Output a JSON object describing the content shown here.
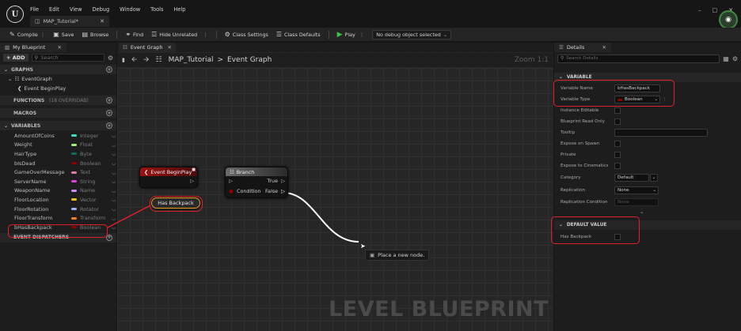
{
  "app": {
    "logo": "U",
    "tab_title": "MAP_Tutorial*"
  },
  "menu": [
    "File",
    "Edit",
    "View",
    "Debug",
    "Window",
    "Tools",
    "Help"
  ],
  "window_controls": [
    "–",
    "□",
    "✕"
  ],
  "toolbar": {
    "compile": "Compile",
    "save": "Save",
    "browse": "Browse",
    "find": "Find",
    "hide_unrelated": "Hide Unrelated",
    "class_settings": "Class Settings",
    "class_defaults": "Class Defaults",
    "play": "Play",
    "debug_select": "No debug object selected"
  },
  "my_blueprint": {
    "tab": "My Blueprint",
    "add": "ADD",
    "search_placeholder": "Search",
    "graphs_header": "GRAPHS",
    "event_graph": "EventGraph",
    "event_begin_play": "Event BeginPlay",
    "functions_header": "FUNCTIONS",
    "functions_sub": "(18 OVERRIDAB)",
    "macros_header": "MACROS",
    "variables_header": "VARIABLES",
    "variables": [
      {
        "name": "AmountOfCoins",
        "type": "Integer",
        "color": "#3ee0c0"
      },
      {
        "name": "Weight",
        "type": "Float",
        "color": "#a0f070"
      },
      {
        "name": "HairType",
        "type": "Byte",
        "color": "#0a6e5c"
      },
      {
        "name": "bIsDead",
        "type": "Boolean",
        "color": "#8c0000"
      },
      {
        "name": "GameOverMessage",
        "type": "Text",
        "color": "#e07aa8"
      },
      {
        "name": "ServerName",
        "type": "String",
        "color": "#e040e0"
      },
      {
        "name": "WeaponName",
        "type": "Name",
        "color": "#c890ff"
      },
      {
        "name": "FloorLocation",
        "type": "Vector",
        "color": "#f0c020"
      },
      {
        "name": "FloorRotation",
        "type": "Rotator",
        "color": "#9ab0ff"
      },
      {
        "name": "FloorTransform",
        "type": "Transform",
        "color": "#f08020"
      },
      {
        "name": "bHasBackpack",
        "type": "Boolean",
        "color": "#8c0000"
      }
    ],
    "event_dispatchers_header": "EVENT DISPATCHERS"
  },
  "graph": {
    "tab": "Event Graph",
    "breadcrumb_root": "MAP_Tutorial",
    "breadcrumb_sep": ">",
    "breadcrumb_leaf": "Event Graph",
    "zoom": "Zoom 1:1",
    "watermark": "LEVEL BLUEPRINT",
    "node_begin_play": "Event BeginPlay",
    "node_branch": "Branch",
    "pin_true": "True",
    "pin_condition": "Condition",
    "pin_false": "False",
    "node_has_backpack": "Has Backpack",
    "place_node": "Place a new node."
  },
  "details": {
    "tab": "Details",
    "search_placeholder": "Search Details",
    "variable_header": "VARIABLE",
    "variable_name_label": "Variable Name",
    "variable_name_value": "bHasBackpack",
    "variable_type_label": "Variable Type",
    "variable_type_value": "Boolean",
    "instance_editable": "Instance Editable",
    "blueprint_read_only": "Blueprint Read Only",
    "tooltip": "Tooltip",
    "expose_on_spawn": "Expose on Spawn",
    "private": "Private",
    "expose_to_cinematics": "Expose to Cinematics",
    "category_label": "Category",
    "category_value": "Default",
    "replication_label": "Replication",
    "replication_value": "None",
    "replication_condition_label": "Replication Condition",
    "replication_condition_value": "None",
    "default_value_header": "DEFAULT VALUE",
    "has_backpack_label": "Has Backpack"
  },
  "colors": {
    "highlight": "#e0202a",
    "event_node": "#8a1010",
    "branch_node": "#5a5a5a",
    "bool_pin": "#8c0000"
  }
}
